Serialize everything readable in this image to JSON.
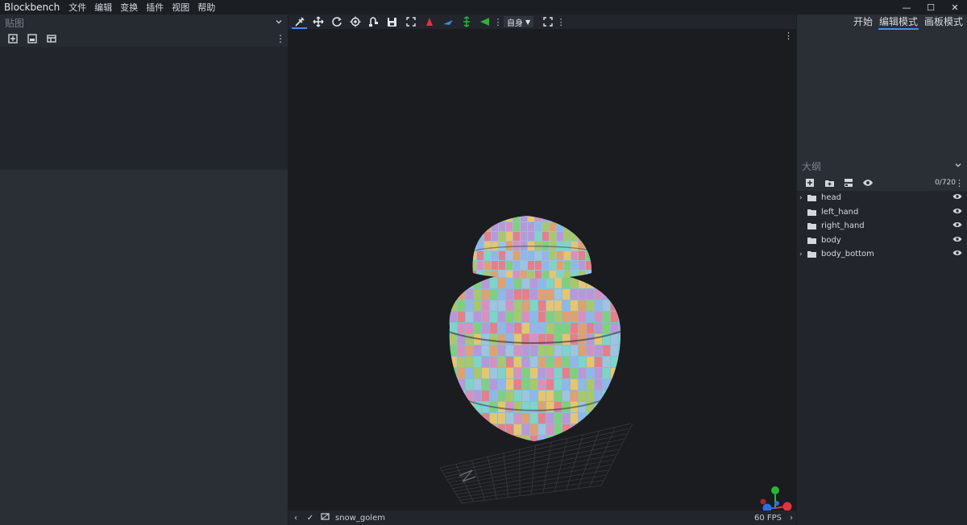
{
  "app": {
    "name": "Blockbench",
    "menu": [
      "文件",
      "编辑",
      "变换",
      "插件",
      "视图",
      "帮助"
    ],
    "window_controls": [
      "—",
      "☐",
      "✕"
    ]
  },
  "modes": {
    "start": "开始",
    "edit": "编辑模式",
    "paint": "画板模式",
    "active": "edit"
  },
  "textures_panel": {
    "title": "贴图"
  },
  "viewport_toolbar": {
    "transform_space": "自身"
  },
  "outliner": {
    "title": "大纲",
    "count": "0/720",
    "nodes": [
      {
        "name": "head",
        "expandable": true
      },
      {
        "name": "left_hand",
        "expandable": false
      },
      {
        "name": "right_hand",
        "expandable": false
      },
      {
        "name": "body",
        "expandable": false
      },
      {
        "name": "body_bottom",
        "expandable": true
      }
    ]
  },
  "status_bar": {
    "model_name": "snow_golem",
    "fps": "60 FPS"
  },
  "colors": {
    "accent": "#3e90ff",
    "gizmo_x": "#e0333f",
    "gizmo_y": "#27b53b",
    "gizmo_z": "#2c6fe0"
  }
}
